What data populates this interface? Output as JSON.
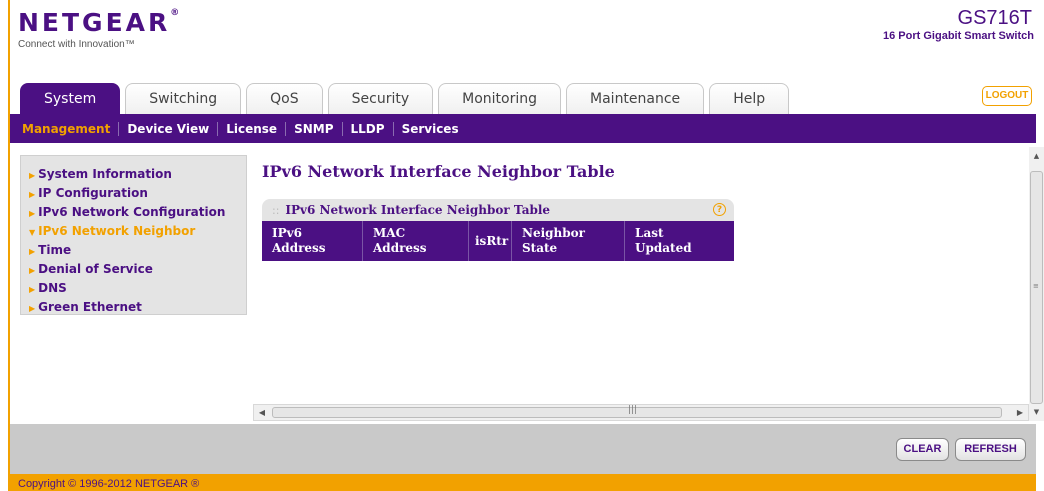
{
  "header": {
    "logo_text": "NETGEAR",
    "logo_mark": "®",
    "tagline": "Connect with Innovation™",
    "model": "GS716T",
    "description": "16 Port Gigabit Smart Switch"
  },
  "tabs": [
    {
      "label": "System",
      "active": true
    },
    {
      "label": "Switching"
    },
    {
      "label": "QoS"
    },
    {
      "label": "Security"
    },
    {
      "label": "Monitoring"
    },
    {
      "label": "Maintenance"
    },
    {
      "label": "Help"
    }
  ],
  "logout_label": "LOGOUT",
  "subnav": [
    {
      "label": "Management",
      "active": true
    },
    {
      "label": "Device View"
    },
    {
      "label": "License"
    },
    {
      "label": "SNMP"
    },
    {
      "label": "LLDP"
    },
    {
      "label": "Services"
    }
  ],
  "sidebar": {
    "items": [
      {
        "label": "System Information"
      },
      {
        "label": "IP Configuration"
      },
      {
        "label": "IPv6 Network Configuration"
      },
      {
        "label": "IPv6 Network Neighbor",
        "active": true
      },
      {
        "label": "Time"
      },
      {
        "label": "Denial of Service"
      },
      {
        "label": "DNS"
      },
      {
        "label": "Green Ethernet"
      }
    ]
  },
  "main": {
    "page_title": "IPv6 Network Interface Neighbor Table",
    "panel_title": "IPv6 Network Interface Neighbor Table",
    "help_glyph": "?",
    "columns": [
      {
        "line1": "IPv6",
        "line2": "Address"
      },
      {
        "line1": "MAC",
        "line2": "Address"
      },
      {
        "line1": "isRtr",
        "line2": ""
      },
      {
        "line1": "Neighbor",
        "line2": "State"
      },
      {
        "line1": "Last",
        "line2": "Updated"
      }
    ]
  },
  "buttons": {
    "clear": "CLEAR",
    "refresh": "REFRESH"
  },
  "footer": {
    "copyright": "Copyright © 1996-2012 NETGEAR ®"
  },
  "colors": {
    "brand_purple": "#4b1083",
    "accent_orange": "#f2a100"
  }
}
